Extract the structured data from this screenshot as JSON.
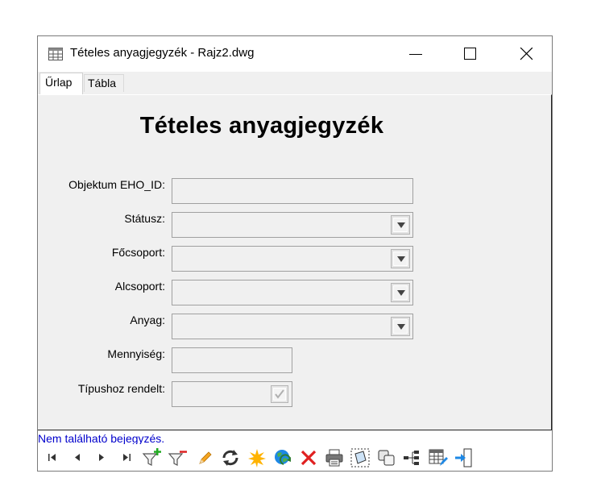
{
  "window": {
    "title": "Tételes anyagjegyzék - Rajz2.dwg"
  },
  "tabs": [
    {
      "label": "Űrlap"
    },
    {
      "label": "Tábla"
    }
  ],
  "form": {
    "title": "Tételes anyagjegyzék",
    "fields": [
      {
        "label": "Objektum EHO_ID:",
        "value": ""
      },
      {
        "label": "Státusz:",
        "value": ""
      },
      {
        "label": "Főcsoport:",
        "value": ""
      },
      {
        "label": "Alcsoport:",
        "value": ""
      },
      {
        "label": "Anyag:",
        "value": ""
      },
      {
        "label": "Mennyiség:",
        "value": ""
      },
      {
        "label": "Típushoz rendelt:",
        "value": ""
      }
    ]
  },
  "status": {
    "message": "Nem található bejegyzés."
  },
  "colors": {
    "status_text": "#0000cc",
    "filter_add": "#22aa22",
    "filter_remove": "#dd2222",
    "delete": "#e02020",
    "new": "#ffb300",
    "link": "#1e88e5"
  },
  "toolbar_icons": [
    "first-record-icon",
    "previous-record-icon",
    "next-record-icon",
    "last-record-icon",
    "add-filter-icon",
    "remove-filter-icon",
    "edit-icon",
    "refresh-icon",
    "new-record-icon",
    "zoom-to-icon",
    "delete-icon",
    "print-icon",
    "select-object-icon",
    "copy-icon",
    "connect-icon",
    "table-settings-icon",
    "exit-icon"
  ]
}
